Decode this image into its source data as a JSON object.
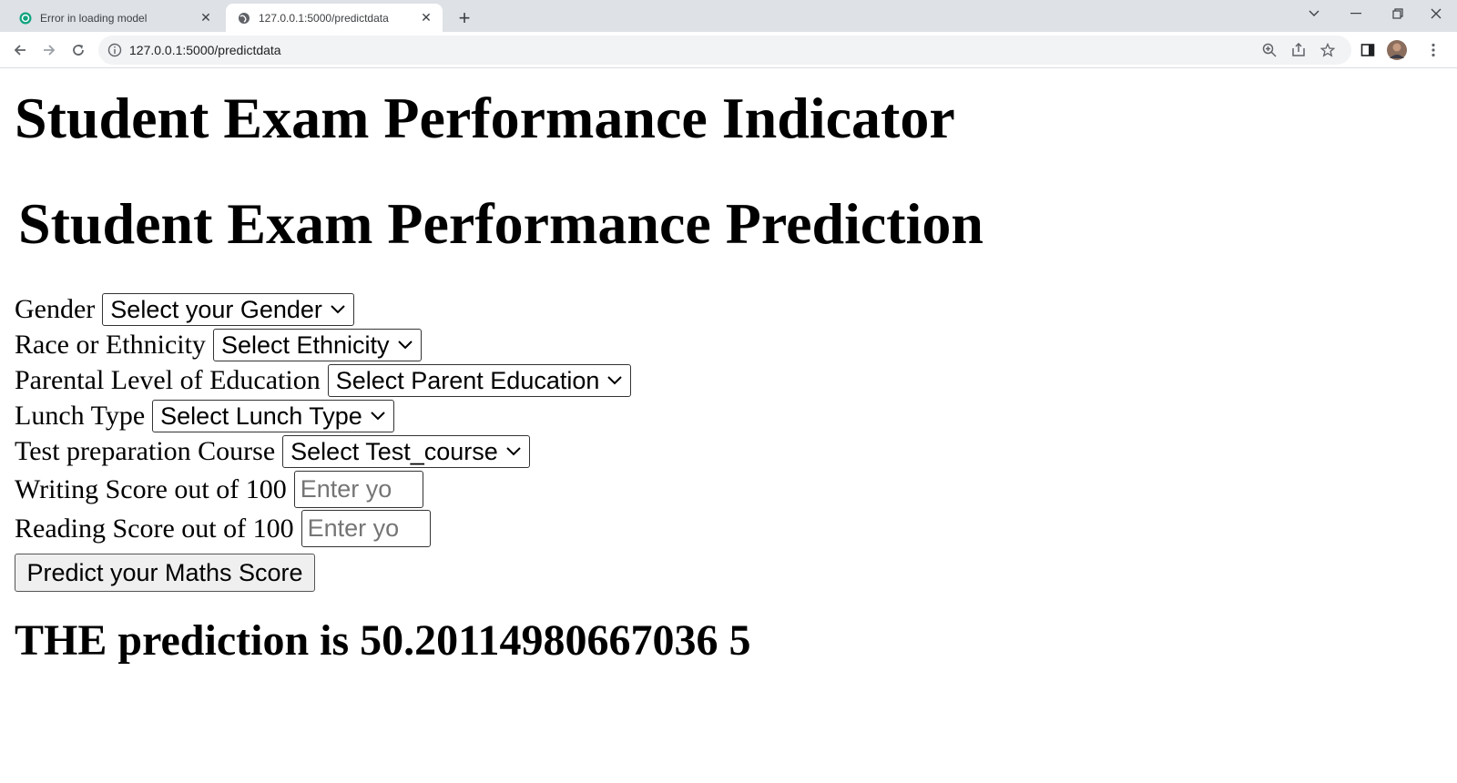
{
  "browser": {
    "tabs": [
      {
        "title": "Error in loading model",
        "active": false,
        "icon": "chatgpt-icon"
      },
      {
        "title": "127.0.0.1:5000/predictdata",
        "active": true,
        "icon": "globe-icon"
      }
    ],
    "address": "127.0.0.1:5000/predictdata"
  },
  "page": {
    "heading": "Student Exam Performance Indicator",
    "form_title": "Student Exam Performance Prediction",
    "fields": {
      "gender": {
        "label": "Gender",
        "selected": "Select your Gender"
      },
      "ethnicity": {
        "label": "Race or Ethnicity",
        "selected": "Select Ethnicity"
      },
      "parent_education": {
        "label": "Parental Level of Education",
        "selected": "Select Parent Education"
      },
      "lunch": {
        "label": "Lunch Type",
        "selected": "Select Lunch Type"
      },
      "test_course": {
        "label": "Test preparation Course",
        "selected": "Select Test_course"
      },
      "writing_score": {
        "label": "Writing Score out of 100",
        "placeholder": "Enter yo"
      },
      "reading_score": {
        "label": "Reading Score out of 100",
        "placeholder": "Enter yo"
      }
    },
    "submit_label": "Predict your Maths Score",
    "prediction": "THE prediction is 50.20114980667036 5"
  }
}
